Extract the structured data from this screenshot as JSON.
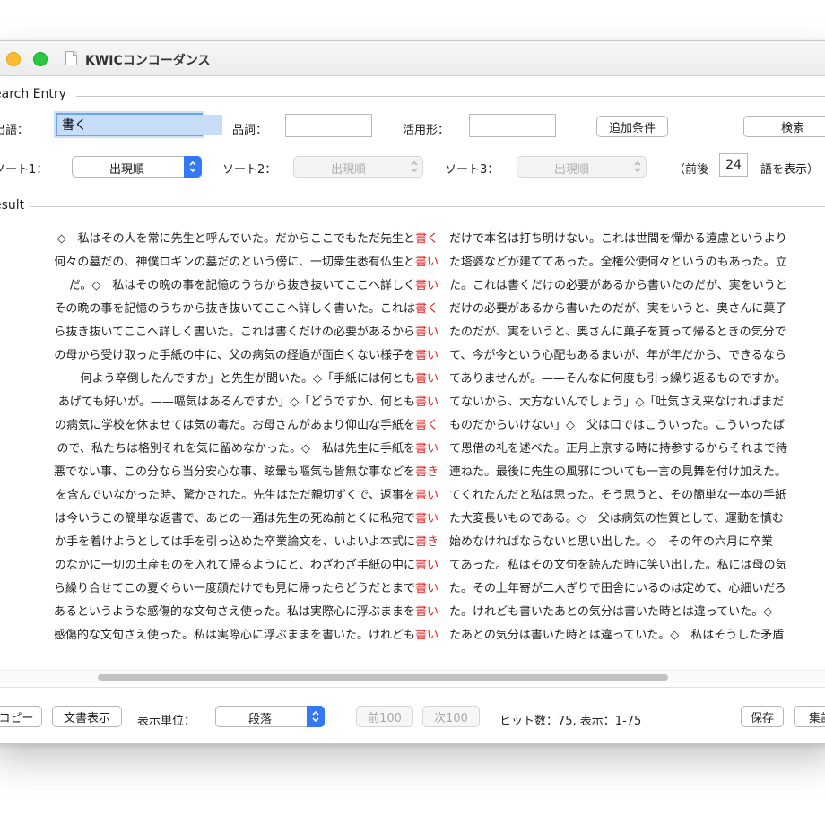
{
  "window": {
    "title": "KWICコンコーダンス"
  },
  "search": {
    "section_title": "earch Entry",
    "headword_label": "出語：",
    "headword_value": "書く",
    "pos_label": "品詞：",
    "pos_value": "",
    "conj_label": "活用形：",
    "conj_value": "",
    "add_condition_label": "追加条件",
    "search_button_label": "検索",
    "sort1_label": "ソート1：",
    "sort1_value": "出現順",
    "sort2_label": "ソート2：",
    "sort2_value": "出現順",
    "sort3_label": "ソート3：",
    "sort3_value": "出現順",
    "context_prefix": "（前後",
    "context_value": "24",
    "context_suffix": "語を表示）"
  },
  "result": {
    "section_title": "esult",
    "rows": [
      {
        "left": "◇　私はその人を常に先生と呼んでいた。だからここでもただ先生と",
        "key": "書く",
        "right": "だけで本名は打ち明けない。これは世間を憚かる遠慮というより"
      },
      {
        "left": "何々の墓だの、神僕ロギンの墓だのという傍に、一切衆生悉有仏生と",
        "key": "書い",
        "right": "た塔婆などが建ててあった。全権公使何々というのもあった。立"
      },
      {
        "left": "だ。◇　私はその晩の事を記憶のうちから抜き抜いてここへ詳しく",
        "key": "書い",
        "right": "た。これは書くだけの必要があるから書いたのだが、実をいうと"
      },
      {
        "left": "その晩の事を記憶のうちから抜き抜いてここへ詳しく書いた。これは",
        "key": "書く",
        "right": "だけの必要があるから書いたのだが、実をいうと、奥さんに菓子"
      },
      {
        "left": "ら抜き抜いてここへ詳しく書いた。これは書くだけの必要があるから",
        "key": "書い",
        "right": "たのだが、実をいうと、奥さんに菓子を貰って帰るときの気分で"
      },
      {
        "left": "の母から受け取った手紙の中に、父の病気の経過が面白くない様子を",
        "key": "書い",
        "right": "て、今が今という心配もあるまいが、年が年だから、できるなら"
      },
      {
        "left": "何よう卒倒したんですか」と先生が聞いた。◇「手紙には何とも",
        "key": "書い",
        "right": "てありませんが。——そんなに何度も引っ繰り返るものですか。"
      },
      {
        "left": "あげても好いが。——嘔気はあるんですか」◇「どうですか、何とも",
        "key": "書い",
        "right": "てないから、大方ないんでしょう」◇「吐気さえ来なければまだ"
      },
      {
        "left": "の病気に学校を休ませては気の毒だ。お母さんがあまり仰山な手紙を",
        "key": "書く",
        "right": "ものだからいけない」◇　父は口ではこういった。こういったば"
      },
      {
        "left": "ので、私たちは格別それを気に留めなかった。◇　私は先生に手紙を",
        "key": "書い",
        "right": "て恩借の礼を述べた。正月上京する時に持参するからそれまで待"
      },
      {
        "left": "悪でない事、この分なら当分安心な事、眩暈も嘔気も皆無な事などを",
        "key": "書き",
        "right": "連ねた。最後に先生の風邪についても一言の見舞を付け加えた。"
      },
      {
        "left": "を含んでいなかった時、驚かされた。先生はただ親切ずくで、返事を",
        "key": "書い",
        "right": "てくれたんだと私は思った。そう思うと、その簡単な一本の手紙"
      },
      {
        "left": "は今いうこの簡単な返書で、あとの一通は先生の死ぬ前とくに私宛で",
        "key": "書い",
        "right": "た大変長いものである。◇　父は病気の性質として、運動を慎む"
      },
      {
        "left": "か手を着けようとしては手を引っ込めた卒業論文を、いよいよ本式に",
        "key": "書き",
        "right": "始めなければならないと思い出した。◇　その年の六月に卒業"
      },
      {
        "left": "のなかに一切の土産ものを入れて帰るようにと、わざわざ手紙の中に",
        "key": "書い",
        "right": "てあった。私はその文句を読んだ時に笑い出した。私には母の気"
      },
      {
        "left": "ら繰り合せてこの夏ぐらい一度顔だけでも見に帰ったらどうだとまで",
        "key": "書い",
        "right": "た。その上年寄が二人ぎりで田舎にいるのは定めて、心細いだろ"
      },
      {
        "left": "あるというような感傷的な文句さえ使った。私は実際心に浮ぶままを",
        "key": "書い",
        "right": "た。けれども書いたあとの気分は書いた時とは違っていた。◇"
      },
      {
        "left": "感傷的な文句さえ使った。私は実際心に浮ぶままを書いた。けれども",
        "key": "書い",
        "right": "たあとの気分は書いた時とは違っていた。◇　私はそうした矛盾"
      }
    ]
  },
  "bottom": {
    "copy_label": "コピー",
    "doc_view_label": "文書表示",
    "unit_label": "表示単位：",
    "unit_value": "段落",
    "prev_label": "前100",
    "next_label": "次100",
    "hits_text": "ヒット数：75, 表示：1-75",
    "save_label": "保存",
    "aggregate_label": "集計"
  },
  "colors": {
    "keyword": "#e41e1e",
    "accent": "#3478f6",
    "focus": "#6aa6e9"
  }
}
